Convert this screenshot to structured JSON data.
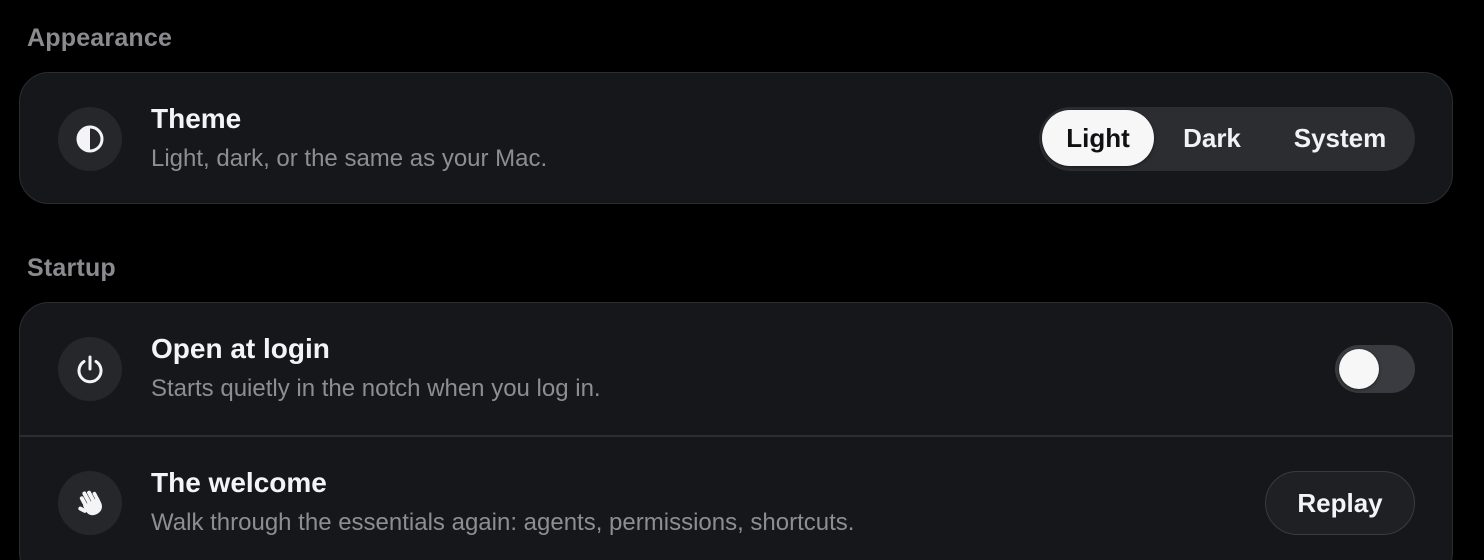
{
  "sections": {
    "appearance": {
      "heading": "Appearance",
      "theme": {
        "title": "Theme",
        "subtitle": "Light, dark, or the same as your Mac.",
        "icon": "half-circle-icon",
        "options": [
          "Light",
          "Dark",
          "System"
        ],
        "selected": "Light"
      }
    },
    "startup": {
      "heading": "Startup",
      "open_at_login": {
        "title": "Open at login",
        "subtitle": "Starts quietly in the notch when you log in.",
        "icon": "power-icon",
        "enabled": false
      },
      "welcome": {
        "title": "The welcome",
        "subtitle": "Walk through the essentials again: agents, permissions, shortcuts.",
        "icon": "waving-hand-icon",
        "button_label": "Replay"
      }
    }
  },
  "colors": {
    "background": "#000000",
    "card": "#16171a",
    "card_border": "#2c2d31",
    "selected_segment": "#f7f7f8",
    "heading": "#8a8a8f"
  }
}
